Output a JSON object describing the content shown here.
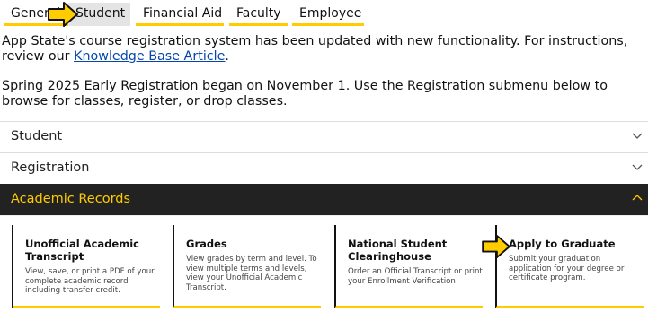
{
  "tabs": [
    {
      "label": "General",
      "active": false
    },
    {
      "label": "Student",
      "active": true
    },
    {
      "label": "Financial Aid",
      "active": false
    },
    {
      "label": "Faculty",
      "active": false
    },
    {
      "label": "Employee",
      "active": false
    }
  ],
  "notice": {
    "text": "App State's course registration system has been updated with new functionality. For instructions, review our ",
    "link_label": "Knowledge Base Article",
    "trailing": ".",
    "registration_text": "Spring 2025 Early Registration began on November 1. Use the Registration submenu below to browse for classes, register, or drop classes."
  },
  "accordion": {
    "student": "Student",
    "registration": "Registration",
    "records": "Academic Records"
  },
  "cards": [
    {
      "title": "Unofficial Academic Transcript",
      "desc": "View, save, or print a PDF of your complete academic record including transfer credit."
    },
    {
      "title": "Grades",
      "desc": "View grades by term and level. To view multiple terms and levels, view your Unofficial Academic Transcript."
    },
    {
      "title": "National Student Clearinghouse",
      "desc": "Order an Official Transcript or print your Enrollment Verification"
    },
    {
      "title": "Apply to Graduate",
      "desc": "Submit your graduation application for your degree or certificate program."
    }
  ],
  "colors": {
    "accent": "#ffcc00",
    "header_dark": "#222222",
    "link": "#0645ad",
    "active_tab": "#e4e4e4"
  },
  "icons": [
    "pointer-arrow-icon",
    "chevron-down-icon",
    "chevron-up-icon"
  ]
}
